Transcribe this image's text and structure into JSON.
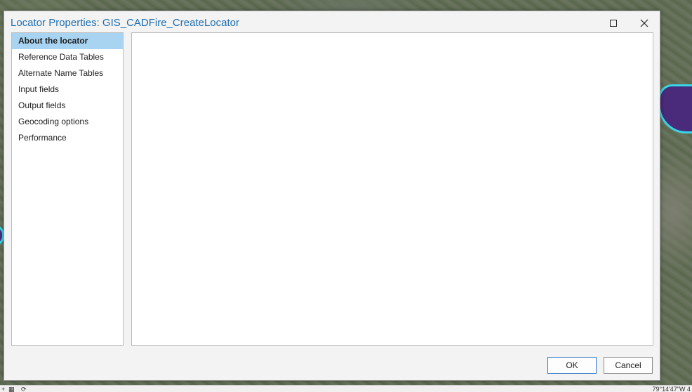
{
  "dialog": {
    "title": "Locator Properties: GIS_CADFire_CreateLocator",
    "nav_items": [
      {
        "label": "About the locator",
        "selected": true
      },
      {
        "label": "Reference Data Tables",
        "selected": false
      },
      {
        "label": "Alternate Name Tables",
        "selected": false
      },
      {
        "label": "Input fields",
        "selected": false
      },
      {
        "label": "Output fields",
        "selected": false
      },
      {
        "label": "Geocoding options",
        "selected": false
      },
      {
        "label": "Performance",
        "selected": false
      }
    ],
    "ok_label": "OK",
    "cancel_label": "Cancel",
    "icons": {
      "maximize": "maximize-icon",
      "close": "close-icon"
    }
  },
  "statusbar": {
    "coordinates": "79°14'47\"W 4"
  },
  "colors": {
    "title": "#1f6fb0",
    "selected_nav": "#a8d4f2",
    "ok_border": "#2b78c5",
    "map_river_fill": "#4a2a7a",
    "map_river_outline": "#37d6e6"
  }
}
